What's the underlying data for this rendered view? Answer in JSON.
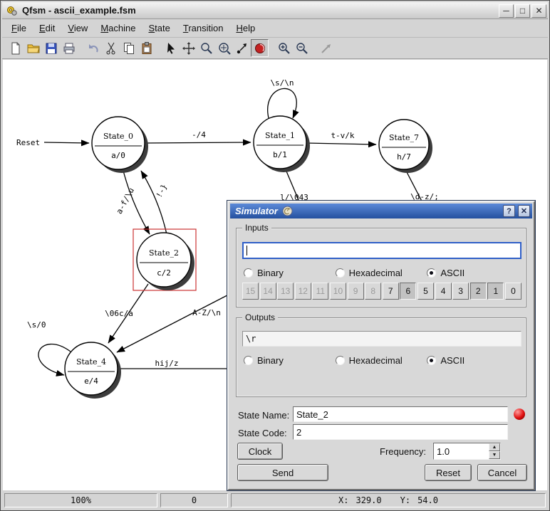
{
  "window": {
    "title": "Qfsm - ascii_example.fsm",
    "icons": {
      "minimize": "─",
      "maximize": "□",
      "close": "✕"
    }
  },
  "menu": {
    "items": [
      {
        "label": "File"
      },
      {
        "label": "Edit"
      },
      {
        "label": "View"
      },
      {
        "label": "Machine"
      },
      {
        "label": "State"
      },
      {
        "label": "Transition"
      },
      {
        "label": "Help"
      }
    ]
  },
  "toolbar": {
    "buttons": [
      "new-file",
      "open-file",
      "save-file",
      "print",
      "undo",
      "cut",
      "copy",
      "paste",
      "select-tool",
      "pan-tool",
      "zoom-select-tool",
      "interactive-zoom-tool",
      "add-transition-tool",
      "simulate-tool",
      "zoom-in",
      "zoom-out",
      "straighten-transitions"
    ],
    "active": "simulate-tool"
  },
  "diagram": {
    "states": [
      {
        "name": "State_0",
        "code": "a/0"
      },
      {
        "name": "State_1",
        "code": "b/1"
      },
      {
        "name": "State_7",
        "code": "h/7"
      },
      {
        "name": "State_2",
        "code": "c/2"
      },
      {
        "name": "State_4",
        "code": "e/4"
      }
    ],
    "labels": {
      "reset": "Reset",
      "s0_s1": "-/4",
      "s1_s7": "t-v/k",
      "s1_self": "\\s/\\n",
      "s0_s2": "a-f/\\u",
      "s2_s0": "!-}",
      "s1_down": "l/\\043",
      "s7_down": "\\d-z/;",
      "s2_s4": "\\06c/a",
      "in_s4": "A-Z/\\n",
      "s4_right": "hij/z",
      "s4_self": "\\s/0"
    },
    "selection_color": "#cc3333"
  },
  "simulator": {
    "title": "Simulator",
    "help_label": "?",
    "close_label": "✕",
    "inputs": {
      "group_label": "Inputs",
      "value": "",
      "encodings": [
        {
          "label": "Binary",
          "checked": false
        },
        {
          "label": "Hexadecimal",
          "checked": false
        },
        {
          "label": "ASCII",
          "checked": true
        }
      ],
      "bit_buttons": [
        {
          "label": "15",
          "state": "disabled"
        },
        {
          "label": "14",
          "state": "disabled"
        },
        {
          "label": "13",
          "state": "disabled"
        },
        {
          "label": "12",
          "state": "disabled"
        },
        {
          "label": "11",
          "state": "disabled"
        },
        {
          "label": "10",
          "state": "disabled"
        },
        {
          "label": "9",
          "state": "disabled"
        },
        {
          "label": "8",
          "state": "disabled"
        },
        {
          "label": "7",
          "state": "normal"
        },
        {
          "label": "6",
          "state": "pressed"
        },
        {
          "label": "5",
          "state": "normal"
        },
        {
          "label": "4",
          "state": "normal"
        },
        {
          "label": "3",
          "state": "normal"
        },
        {
          "label": "2",
          "state": "pressed"
        },
        {
          "label": "1",
          "state": "pressed"
        },
        {
          "label": "0",
          "state": "normal"
        }
      ]
    },
    "outputs": {
      "group_label": "Outputs",
      "value": "\\r",
      "encodings": [
        {
          "label": "Binary",
          "checked": false
        },
        {
          "label": "Hexadecimal",
          "checked": false
        },
        {
          "label": "ASCII",
          "checked": true
        }
      ]
    },
    "state_name_label": "State Name:",
    "state_name": "State_2",
    "state_code_label": "State Code:",
    "state_code": "2",
    "clock_label": "Clock",
    "frequency_label": "Frequency:",
    "frequency": "1.0",
    "spin_up": "▲",
    "spin_down": "▼",
    "send_label": "Send",
    "reset_label": "Reset",
    "cancel_label": "Cancel"
  },
  "statusbar": {
    "zoom": "100%",
    "counter": "0",
    "x_label": "X:",
    "x_value": "329.0",
    "y_label": "Y:",
    "y_value": "54.0"
  }
}
